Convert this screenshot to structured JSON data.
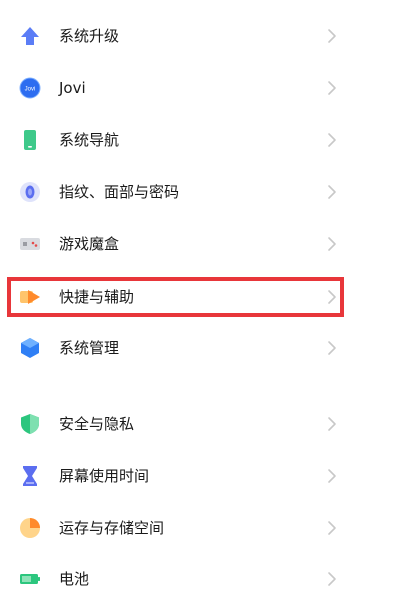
{
  "settings": {
    "group1": [
      {
        "label": "系统升级",
        "icon": "system-update-icon"
      },
      {
        "label": "Jovi",
        "icon": "jovi-icon"
      },
      {
        "label": "系统导航",
        "icon": "system-navigation-icon"
      },
      {
        "label": "指纹、面部与密码",
        "icon": "fingerprint-icon"
      },
      {
        "label": "游戏魔盒",
        "icon": "game-box-icon"
      },
      {
        "label": "快捷与辅助",
        "icon": "shortcut-assist-icon"
      },
      {
        "label": "系统管理",
        "icon": "system-management-icon"
      }
    ],
    "group2": [
      {
        "label": "安全与隐私",
        "icon": "security-privacy-icon"
      },
      {
        "label": "屏幕使用时间",
        "icon": "screen-time-icon"
      },
      {
        "label": "运存与存储空间",
        "icon": "storage-icon"
      },
      {
        "label": "电池",
        "icon": "battery-icon"
      }
    ],
    "jovi_icon_text": "Jovi"
  },
  "colors": {
    "highlight": "#e8363a",
    "chevron": "#c8c8c8",
    "text": "#1a1a1a"
  }
}
